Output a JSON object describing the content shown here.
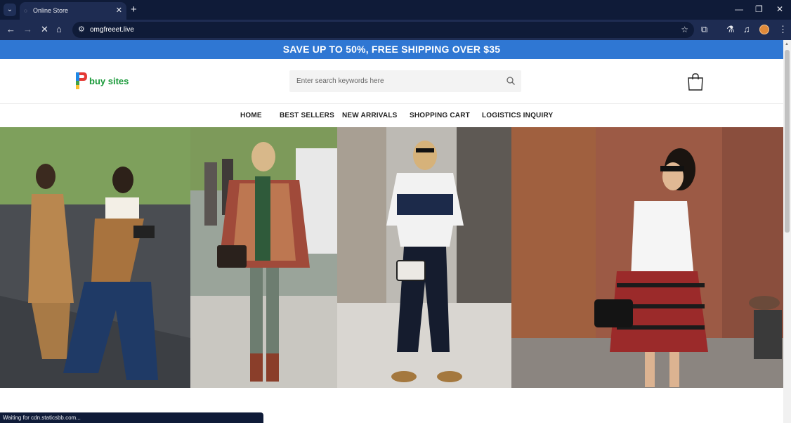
{
  "browser": {
    "tab_title": "Online Store",
    "url": "omgfreeet.live",
    "status_text": "Waiting for cdn.staticsbb.com..."
  },
  "promo": {
    "text": "SAVE UP TO 50%, FREE SHIPPING OVER $35"
  },
  "header": {
    "logo_text": "buy sites",
    "search_placeholder": "Enter search keywords here"
  },
  "nav": {
    "items": [
      "HOME",
      "BEST SELLERS",
      "NEW ARRIVALS",
      "SHOPPING CART",
      "LOGISTICS INQUIRY"
    ]
  },
  "icons": {
    "search": "search-icon",
    "cart": "shopping-bag-icon",
    "back": "arrow-left-icon",
    "forward": "arrow-right-icon",
    "stop": "close-icon",
    "home": "home-icon",
    "bookmark": "star-icon"
  },
  "colors": {
    "promo_bar": "#2f77d3",
    "logo_green": "#1a9a3a",
    "browser_dark": "#0f1b38"
  }
}
